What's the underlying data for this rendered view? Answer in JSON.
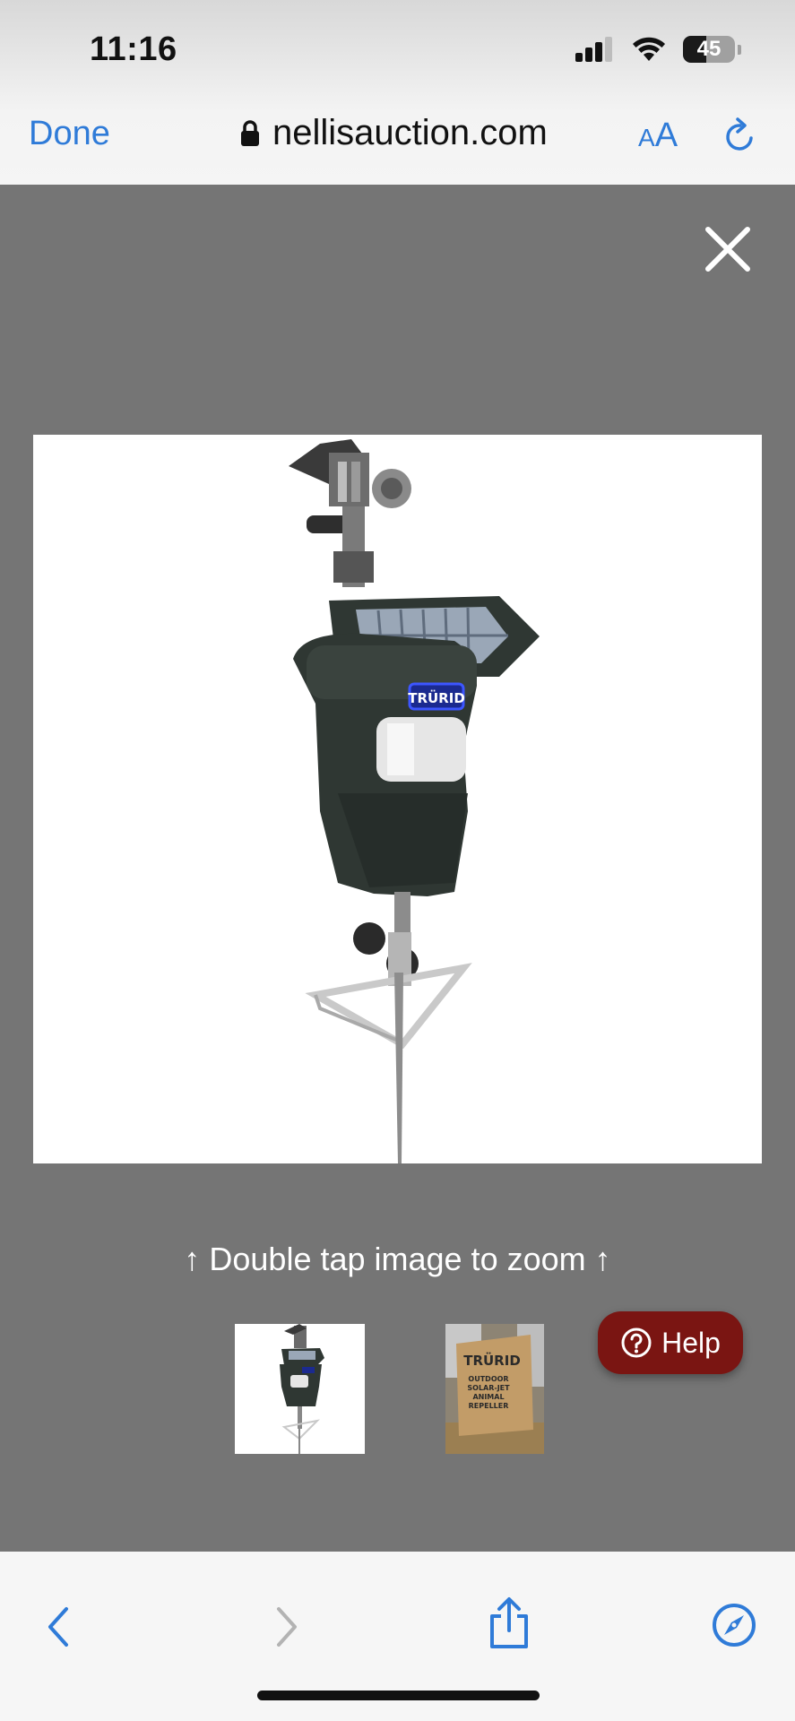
{
  "status_bar": {
    "time": "11:16",
    "battery": "45",
    "battery_fraction": 0.45,
    "icons": [
      "signal-icon",
      "wifi-icon",
      "battery-icon"
    ]
  },
  "browser": {
    "done_label": "Done",
    "url": "nellisauction.com",
    "aa_small": "A",
    "aa_large": "A",
    "accent_color": "#2f7bd8"
  },
  "viewer": {
    "zoom_hint": "↑ Double tap image to zoom ↑",
    "product_brand_label": "TRÜRID",
    "thumbnail_box_text": [
      "TRÜRID",
      "OUTDOOR",
      "SOLAR-JET",
      "ANIMAL",
      "REPELLER"
    ],
    "help_label": "Help",
    "help_color": "#7a1512"
  },
  "toolbar": {
    "icons": [
      "back-icon",
      "forward-icon",
      "share-icon",
      "compass-icon"
    ]
  }
}
